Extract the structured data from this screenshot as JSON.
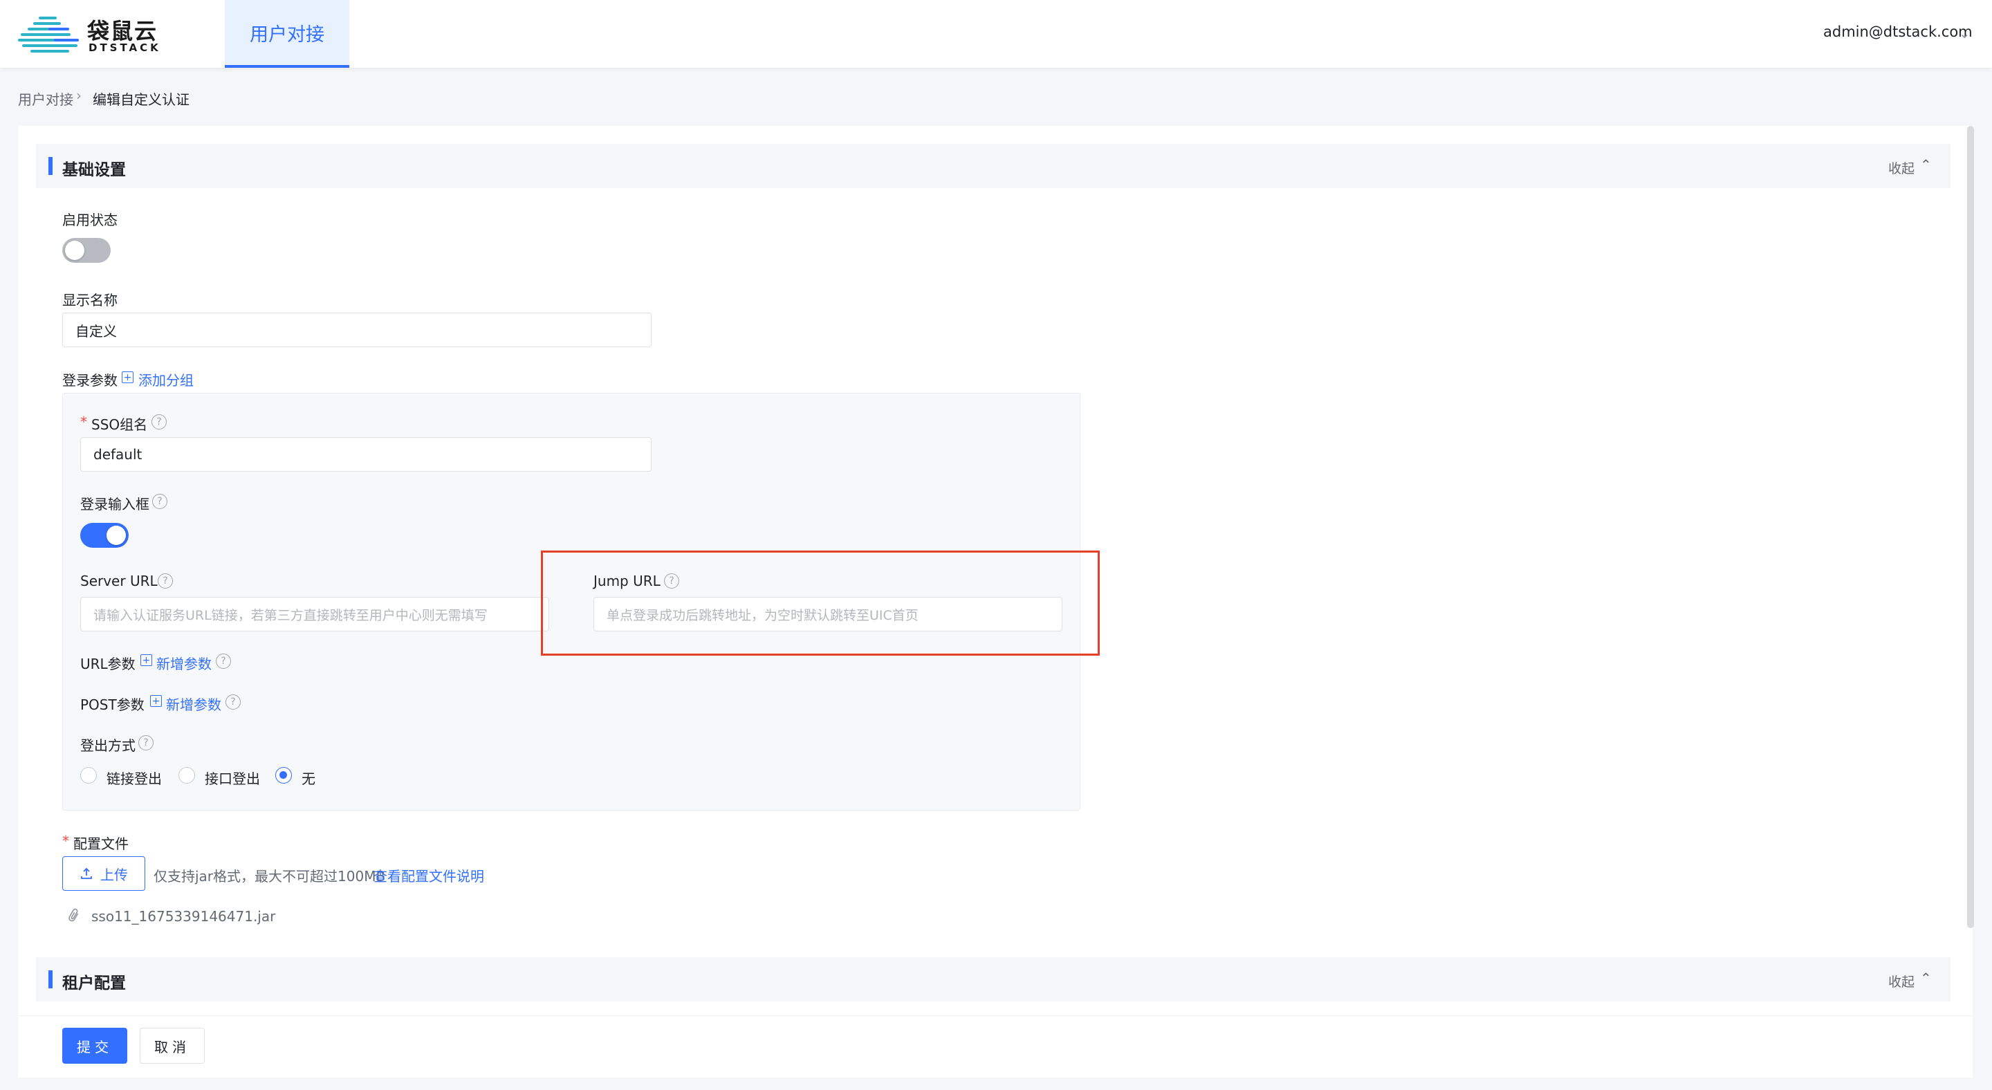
{
  "app": {
    "logo_cn": "袋鼠云",
    "logo_en": "DTSTACK",
    "nav_tab": "用户对接",
    "user_email": "admin@dtstack.com"
  },
  "breadcrumb": {
    "parent": "用户对接",
    "current": "编辑自定义认证"
  },
  "basic_section": {
    "title": "基础设置",
    "collapse_label": "收起",
    "enable_status_label": "启用状态",
    "enable_status_on": false,
    "display_name_label": "显示名称",
    "display_name_value": "自定义",
    "login_params_label": "登录参数",
    "add_group_label": "添加分组",
    "sso_group_label": "SSO组名",
    "sso_group_value": "default",
    "login_input_label": "登录输入框",
    "login_input_on": true,
    "server_url_label": "Server URL",
    "server_url_placeholder": "请输入认证服务URL链接，若第三方直接跳转至用户中心则无需填写",
    "jump_url_label": "Jump URL",
    "jump_url_placeholder": "单点登录成功后跳转地址，为空时默认跳转至UIC首页",
    "url_params_label": "URL参数",
    "post_params_label": "POST参数",
    "add_param_label": "新增参数",
    "logout_label": "登出方式",
    "logout_options": [
      "链接登出",
      "接口登出",
      "无"
    ],
    "logout_selected": "无",
    "config_file_label": "配置文件",
    "upload_label": "上传",
    "upload_hint": "仅支持jar格式，最大不可超过100MB",
    "upload_doc_link": "查看配置文件说明",
    "file_name": "sso11_1675339146471.jar"
  },
  "tenant_section": {
    "title": "租户配置",
    "collapse_label": "收起"
  },
  "actions": {
    "submit_label": "提交",
    "cancel_label": "取消"
  },
  "colors": {
    "accent": "#3370ff",
    "highlight_box": "#e5402a",
    "required": "#f54a45"
  }
}
